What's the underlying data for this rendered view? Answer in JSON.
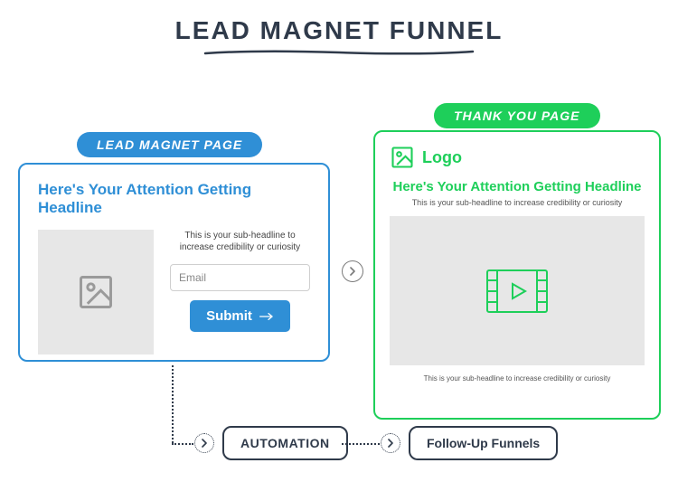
{
  "title": "LEAD MAGNET FUNNEL",
  "badges": {
    "lead_magnet": "LEAD MAGNET PAGE",
    "thank_you": "THANK YOU PAGE"
  },
  "lead_magnet_card": {
    "headline": "Here's Your Attention Getting Headline",
    "subheadline": "This is your sub-headline to increase credibility or curiosity",
    "email_placeholder": "Email",
    "submit_label": "Submit"
  },
  "thank_you_card": {
    "logo_label": "Logo",
    "headline": "Here's Your Attention Getting Headline",
    "subheadline": "This is your sub-headline to increase credibility or curiosity",
    "footnote": "This is your sub-headline to increase credibility or curiosity"
  },
  "bottom": {
    "automation": "AUTOMATION",
    "follow_up": "Follow-Up Funnels"
  },
  "colors": {
    "blue": "#2f8fd6",
    "green": "#1ecf5a",
    "dark": "#2f3a4a",
    "placeholder_bg": "#e7e7e7"
  }
}
